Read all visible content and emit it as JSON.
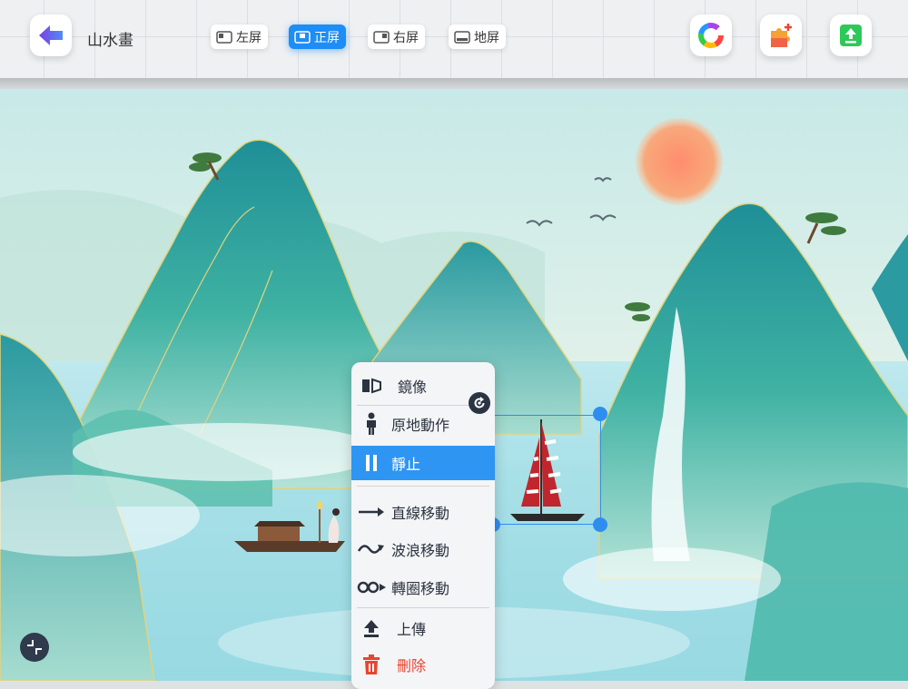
{
  "app": {
    "title": "山水畫"
  },
  "toolbar": {
    "screens": [
      {
        "label": "左屏",
        "active": false
      },
      {
        "label": "正屏",
        "active": true
      },
      {
        "label": "右屏",
        "active": false
      },
      {
        "label": "地屏",
        "active": false
      }
    ],
    "icons": [
      "back-arrow-icon",
      "color-wheel-icon",
      "puzzle-add-icon",
      "upload-icon"
    ]
  },
  "context_menu": {
    "items": [
      {
        "label": "鏡像",
        "icon": "mirror-icon"
      },
      {
        "label": "原地動作",
        "icon": "person-icon"
      },
      {
        "label": "靜止",
        "icon": "pause-icon",
        "active": true
      },
      {
        "label": "直線移動",
        "icon": "arrow-right-icon"
      },
      {
        "label": "波浪移動",
        "icon": "wave-icon"
      },
      {
        "label": "轉圈移動",
        "icon": "loop-icon"
      },
      {
        "label": "上傳",
        "icon": "upload-icon"
      },
      {
        "label": "刪除",
        "icon": "trash-icon",
        "danger": true
      }
    ]
  },
  "colors": {
    "accent": "#1e8df5",
    "danger": "#e8442f",
    "sun": "#f9836a",
    "sail": "#c0262d"
  }
}
